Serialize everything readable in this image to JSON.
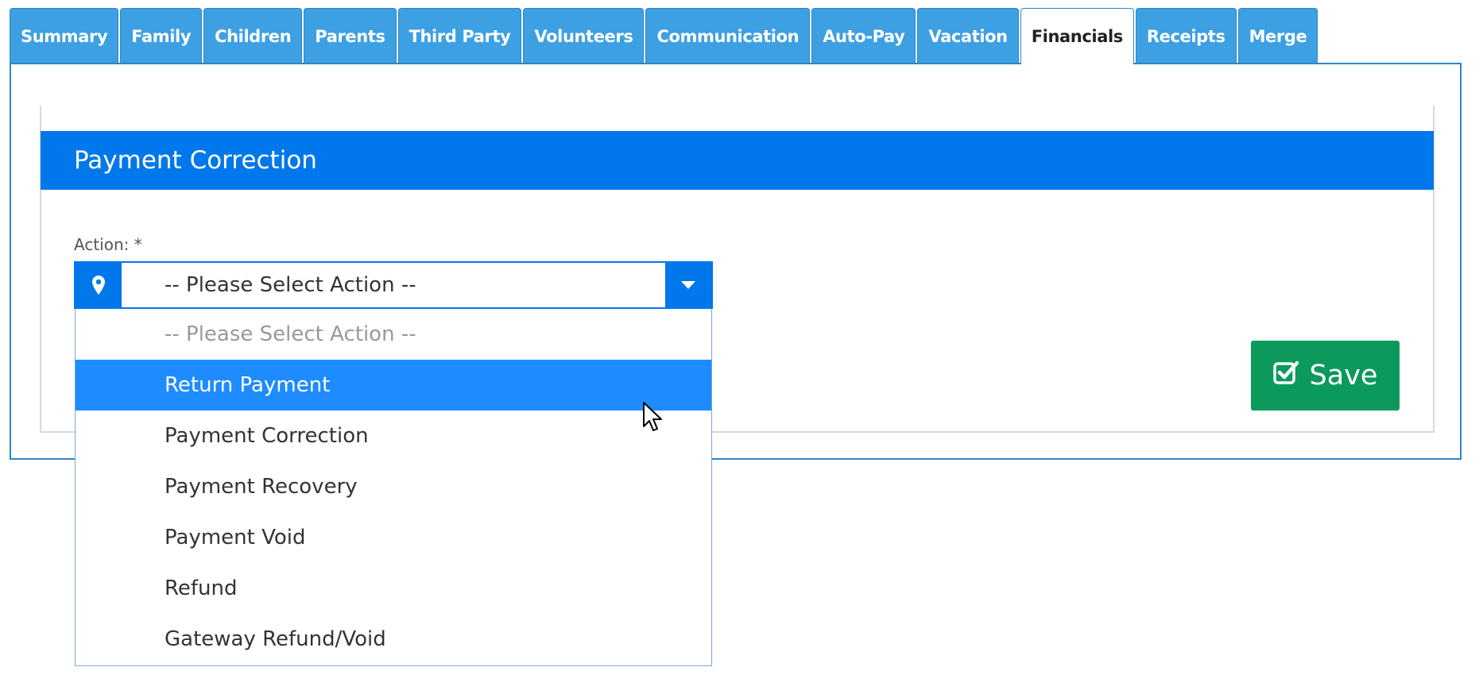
{
  "tabs": [
    {
      "label": "Summary",
      "active": false
    },
    {
      "label": "Family",
      "active": false
    },
    {
      "label": "Children",
      "active": false
    },
    {
      "label": "Parents",
      "active": false
    },
    {
      "label": "Third Party",
      "active": false
    },
    {
      "label": "Volunteers",
      "active": false
    },
    {
      "label": "Communication",
      "active": false
    },
    {
      "label": "Auto-Pay",
      "active": false
    },
    {
      "label": "Vacation",
      "active": false
    },
    {
      "label": "Financials",
      "active": true
    },
    {
      "label": "Receipts",
      "active": false
    },
    {
      "label": "Merge",
      "active": false
    }
  ],
  "section": {
    "title": "Payment Correction"
  },
  "action_field": {
    "label": "Action: *",
    "selected": "-- Please Select Action --",
    "icon": "map-marker-icon",
    "caret_icon": "caret-down-icon",
    "options": [
      {
        "label": "-- Please Select Action --",
        "placeholder": true
      },
      {
        "label": "Return Payment",
        "highlighted": true
      },
      {
        "label": "Payment Correction"
      },
      {
        "label": "Payment Recovery"
      },
      {
        "label": "Payment Void"
      },
      {
        "label": "Refund"
      },
      {
        "label": "Gateway Refund/Void"
      }
    ]
  },
  "save_button": {
    "label": "Save",
    "icon": "check-square-icon"
  },
  "colors": {
    "tab_bg": "#3da0e3",
    "header_bg": "#0077ea",
    "highlight_bg": "#1e8cff",
    "save_bg": "#0b9a5c"
  }
}
